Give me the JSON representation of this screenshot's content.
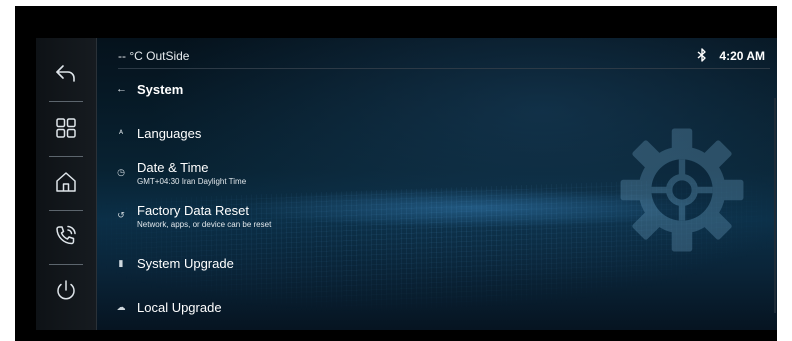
{
  "status": {
    "temperature": "-- °C OutSide",
    "time": "4:20 AM",
    "bluetooth_icon": "bluetooth-icon"
  },
  "header": {
    "back_icon": "←",
    "title": "System"
  },
  "sidebar": [
    {
      "icon": "back-icon"
    },
    {
      "icon": "apps-grid-icon"
    },
    {
      "icon": "home-icon"
    },
    {
      "icon": "phone-icon"
    },
    {
      "icon": "power-icon"
    }
  ],
  "items": [
    {
      "icon": "translate-icon",
      "label": "Languages",
      "sub": ""
    },
    {
      "icon": "clock-icon",
      "label": "Date & Time",
      "sub": "GMT+04:30 Iran Daylight Time"
    },
    {
      "icon": "reset-icon",
      "label": "Factory Data Reset",
      "sub": "Network, apps, or device can be reset"
    },
    {
      "icon": "sd-card-icon",
      "label": "System Upgrade",
      "sub": ""
    },
    {
      "icon": "cloud-icon",
      "label": "Local Upgrade",
      "sub": ""
    }
  ],
  "icon_glyphs": {
    "translate": "ᴬ",
    "clock": "◷",
    "reset": "↺",
    "sd_card": "▮",
    "cloud": "☁"
  },
  "colors": {
    "background": "#082232",
    "sidebar": "#141a1f",
    "text": "#ffffff"
  }
}
